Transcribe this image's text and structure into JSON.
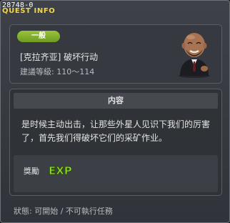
{
  "window": {
    "id": "28748-0",
    "title": "QUEST INFO"
  },
  "quest": {
    "category_badge": "一般",
    "name": "[克拉齐亚] 破坏行动",
    "level": "建議等級: 110～114"
  },
  "content": {
    "header": "内容",
    "description_line1": "是时候主动出击，让那些外星人见识下我们的厉害",
    "description_line2": "了，首先我们得破坏它们的采矿作业。"
  },
  "reward": {
    "label": "獎勵",
    "icon_text": "EXP"
  },
  "status": {
    "text": "狀態: 可開始 / 不可執行任務"
  },
  "colors": {
    "title_yellow": "#f2d54a",
    "badge_green": "#86b432",
    "exp_green": "#96e52a"
  },
  "icons": {
    "npc": "bald-bearded-man-in-suit-portrait",
    "reward": "exp-icon"
  }
}
